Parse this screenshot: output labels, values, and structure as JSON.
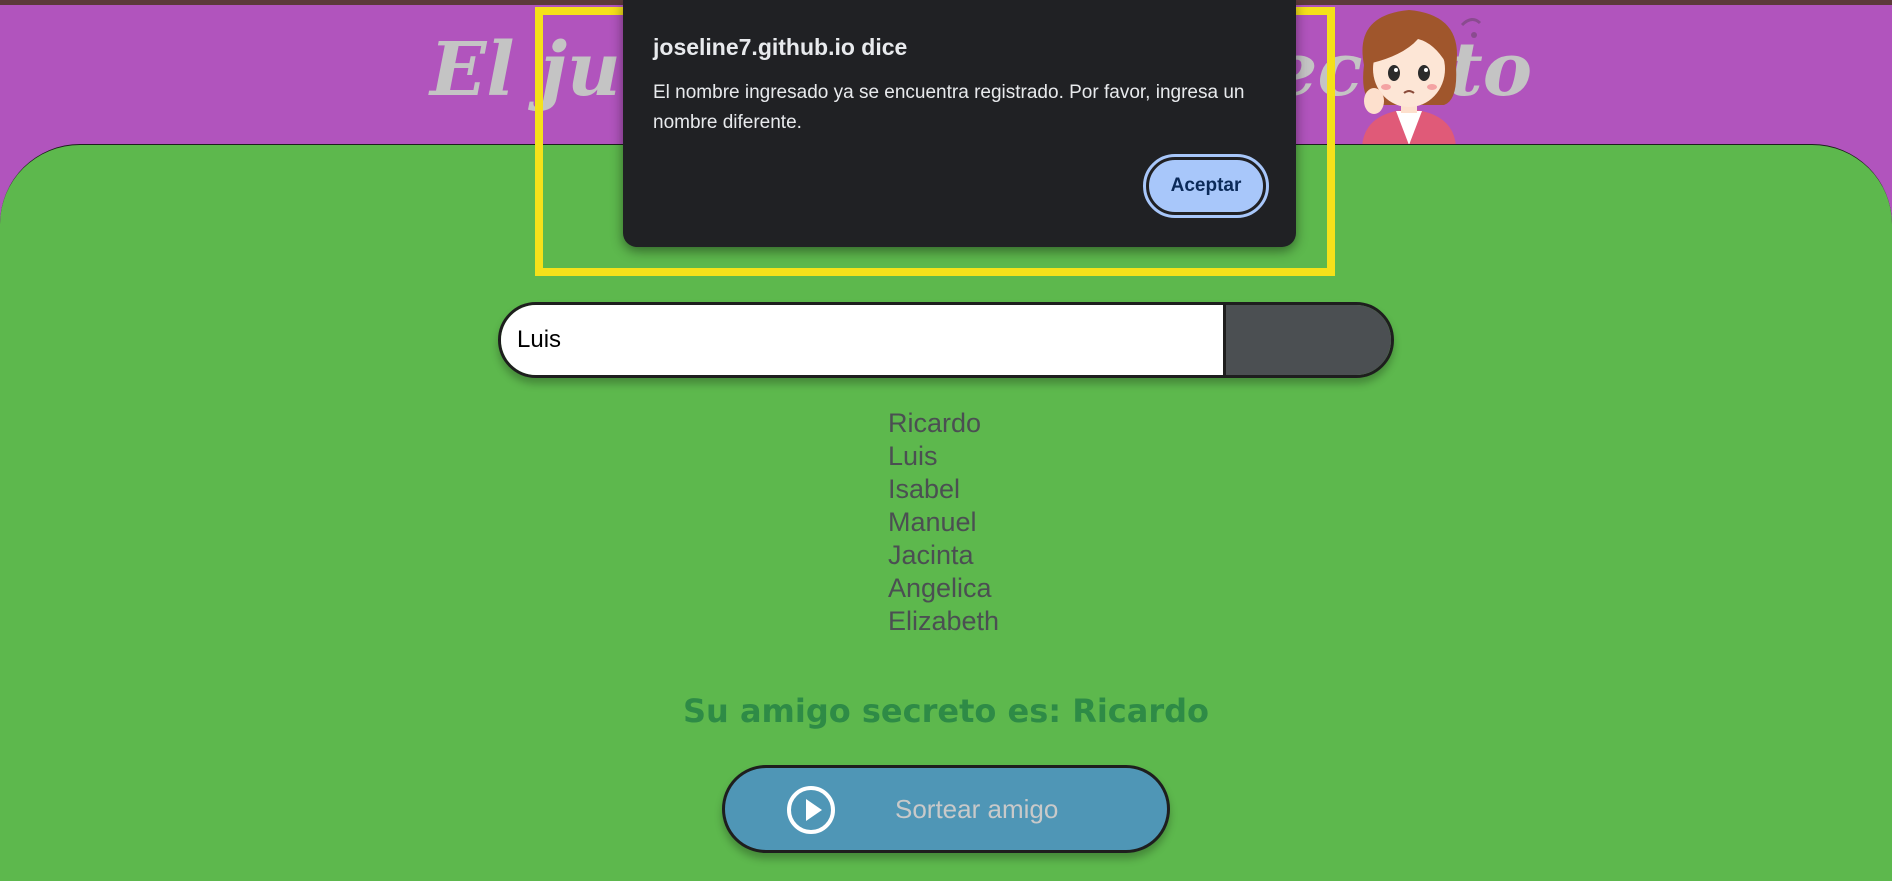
{
  "header": {
    "title": "El juego del amigo secreto"
  },
  "form": {
    "name_value": "Luis",
    "add_label": ""
  },
  "names": [
    "Ricardo",
    "Luis",
    "Isabel",
    "Manuel",
    "Jacinta",
    "Angelica",
    "Elizabeth"
  ],
  "result": {
    "text": "Su amigo secreto es: Ricardo"
  },
  "draw_button": {
    "label": "Sortear amigo",
    "icon": "play-circle-icon"
  },
  "dialog": {
    "title": "joseline7.github.io dice",
    "message": "El nombre ingresado ya se encuentra registrado. Por favor, ingresa un nombre diferente.",
    "ok_label": "Aceptar"
  },
  "colors": {
    "header_bg": "#b154bd",
    "main_bg": "#5db84d",
    "dialog_bg": "#202124",
    "dialog_button": "#a8c7fa",
    "highlight": "#f5e11a",
    "draw_button_bg": "#4f96b6",
    "result_text": "#2e8b46"
  }
}
